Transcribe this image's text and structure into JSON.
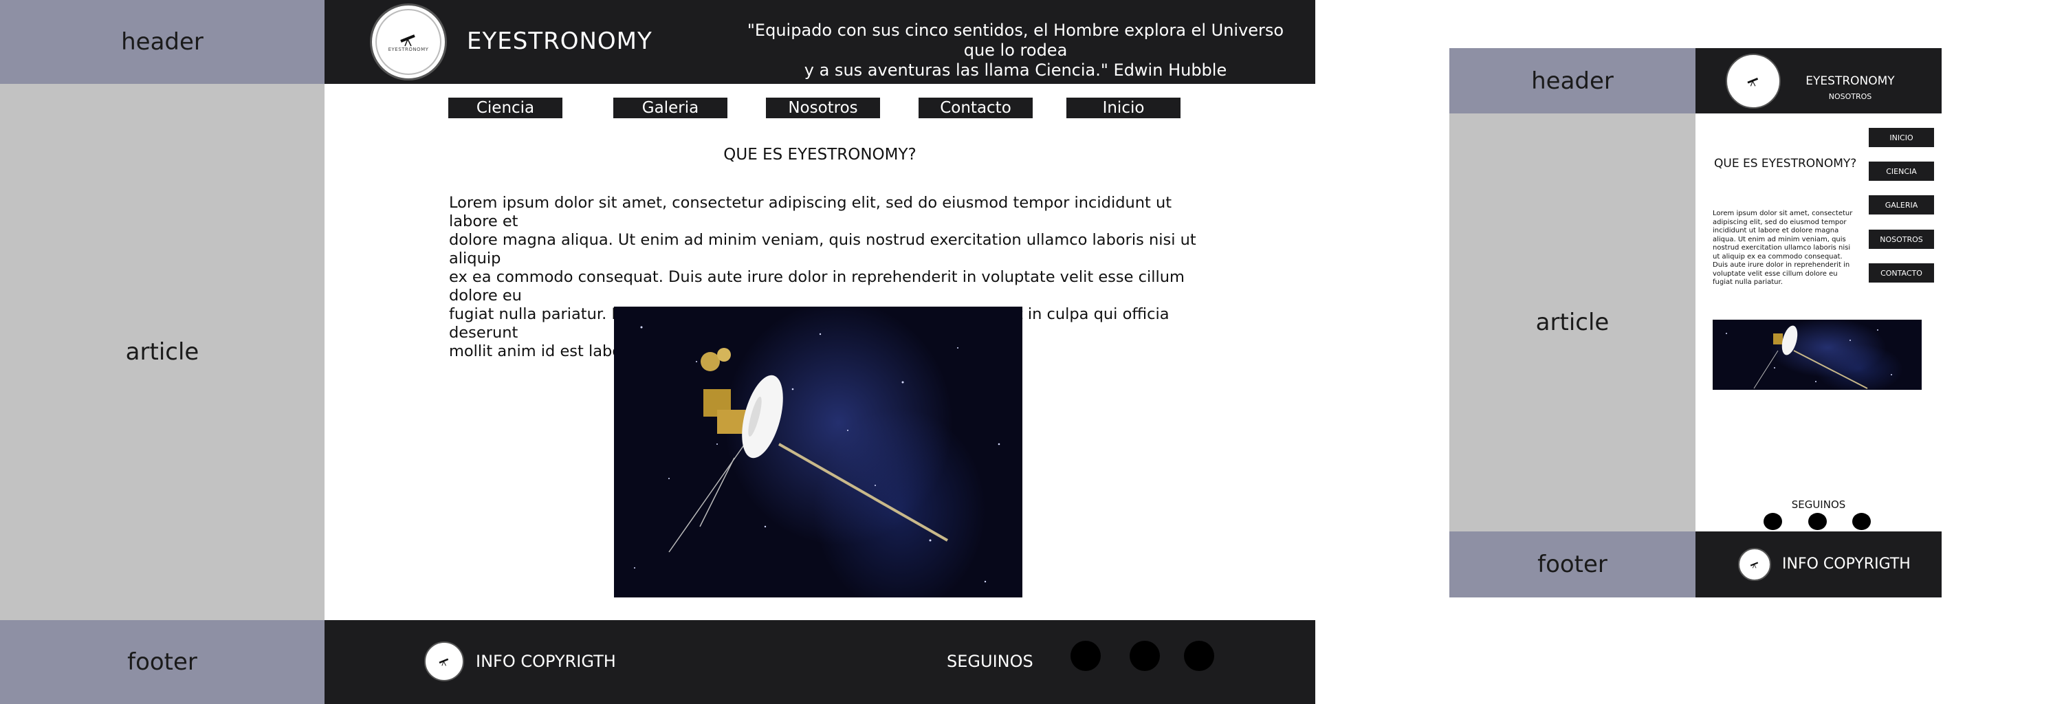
{
  "desktop": {
    "labels": {
      "header": "header",
      "article": "article",
      "footer": "footer"
    },
    "brand": {
      "name": "EYESTRONOMY",
      "logo_text": "EYESTRONOMY"
    },
    "quote": {
      "line1": "\"Equipado con sus cinco sentidos, el Hombre explora el Universo que lo rodea",
      "line2": "y a sus aventuras las llama Ciencia.\" Edwin Hubble"
    },
    "nav": [
      {
        "label": "Ciencia"
      },
      {
        "label": "Galeria"
      },
      {
        "label": "Nosotros"
      },
      {
        "label": "Contacto"
      },
      {
        "label": "Inicio"
      }
    ],
    "article": {
      "heading": "QUE ES EYESTRONOMY?",
      "body_lines": [
        "Lorem ipsum dolor sit amet, consectetur adipiscing elit, sed do eiusmod tempor incididunt ut labore et",
        "dolore magna aliqua. Ut enim ad minim veniam, quis nostrud exercitation ullamco laboris nisi ut aliquip",
        "ex ea commodo consequat. Duis aute irure dolor in reprehenderit in voluptate velit esse cillum dolore eu",
        "fugiat nulla pariatur. Excepteur sint occaecat cupidatat non proident, sunt in culpa qui officia deserunt",
        "mollit anim id est laborum."
      ]
    },
    "footer": {
      "copyright": "INFO COPYRIGTH",
      "follow": "SEGUINOS"
    }
  },
  "mobile": {
    "labels": {
      "header": "header",
      "article": "article",
      "footer": "footer"
    },
    "brand": {
      "name": "EYESTRONOMY",
      "sub": "NOSOTROS"
    },
    "nav": [
      {
        "label": "INICIO"
      },
      {
        "label": "CIENCIA"
      },
      {
        "label": "GALERIA"
      },
      {
        "label": "NOSOTROS"
      },
      {
        "label": "CONTACTO"
      }
    ],
    "article": {
      "heading": "QUE ES EYESTRONOMY?",
      "body_lines": [
        "Lorem ipsum dolor sit amet, consectetur",
        "adipiscing elit, sed do eiusmod tempor",
        "incididunt ut labore et dolore magna",
        "aliqua. Ut enim ad minim veniam, quis",
        "nostrud exercitation ullamco laboris nisi",
        "ut aliquip ex ea commodo consequat.",
        "Duis aute irure dolor in reprehenderit in",
        "voluptate velit esse cillum dolore eu",
        "fugiat nulla pariatur."
      ]
    },
    "footer": {
      "copyright": "INFO COPYRIGTH",
      "follow": "SEGUINOS"
    }
  }
}
